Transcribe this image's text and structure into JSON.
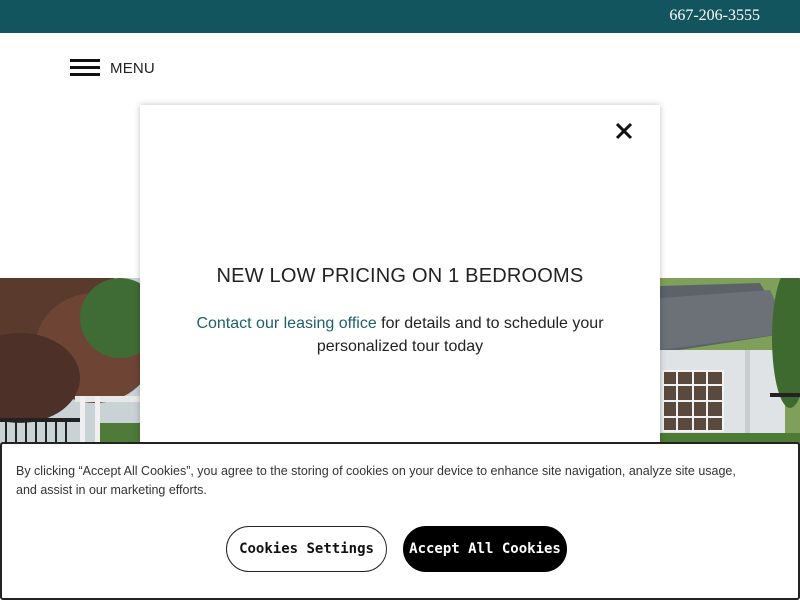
{
  "header": {
    "phone": "667-206-3555",
    "menu_label": "MENU"
  },
  "colors": {
    "topbar": "#13555f",
    "link": "#1f5f6c",
    "accept_button": "#000000"
  },
  "icons": {
    "menu": "hamburger-icon",
    "close": "close-icon"
  },
  "modal": {
    "title": "NEW LOW PRICING ON 1 BEDROOMS",
    "link_text": "Contact our leasing office",
    "body_text": " for details and to schedule your personalized tour today"
  },
  "cookie_banner": {
    "text": "By clicking “Accept All Cookies”, you agree to the storing of cookies on your device to enhance site navigation, analyze site usage, and assist in our marketing efforts.",
    "settings_label": "Cookies Settings",
    "accept_label": "Accept All Cookies"
  }
}
